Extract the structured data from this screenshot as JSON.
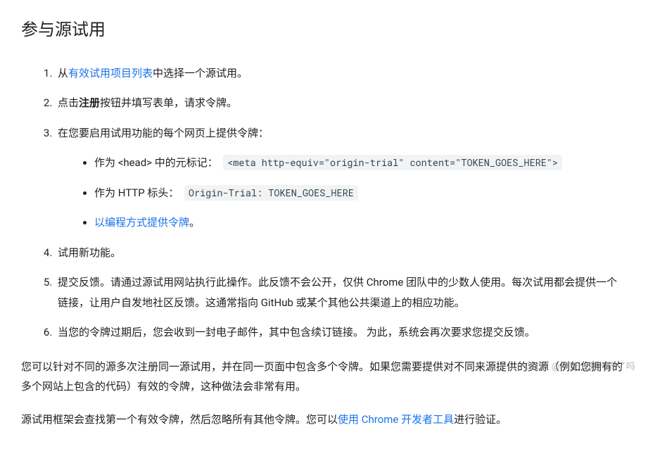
{
  "heading": "参与源试用",
  "list": {
    "item1": {
      "pre": "从",
      "link": "有效试用项目列表",
      "post": "中选择一个源试用。"
    },
    "item2": {
      "pre": "点击",
      "bold": "注册",
      "post": "按钮并填写表单，请求令牌。"
    },
    "item3": {
      "text": "在您要启用试用功能的每个网页上提供令牌：",
      "sub1": {
        "pre": "作为 <head> 中的元标记：",
        "code": "<meta http-equiv=\"origin-trial\" content=\"TOKEN_GOES_HERE\">"
      },
      "sub2": {
        "pre": "作为 HTTP 标头：",
        "code": "Origin-Trial: TOKEN_GOES_HERE"
      },
      "sub3": {
        "link": "以编程方式提供令牌",
        "post": "。"
      }
    },
    "item4": "试用新功能。",
    "item5": "提交反馈。请通过源试用网站执行此操作。此反馈不会公开，仅供 Chrome 团队中的少数人使用。每次试用都会提供一个链接，让用户自发地社区反馈。这通常指向 GitHub 或某个其他公共渠道上的相应功能。",
    "item6": "当您的令牌过期后，您会收到一封电子邮件，其中包含续订链接。 为此，系统会再次要求您提交反馈。"
  },
  "para1": "您可以针对不同的源多次注册同一源试用，并在同一页面中包含多个令牌。如果您需要提供对不同来源提供的资源（例如您拥有的多个网站上包含的代码）有效的令牌，这种做法会非常有用。",
  "para2": {
    "pre": "源试用框架会查找第一个有效令牌，然后忽略所有其他令牌。您可以",
    "link": "使用 Chrome 开发者工具",
    "post": "进行验证。"
  },
  "watermark": "CSDN @今天hz敲代码了吗"
}
